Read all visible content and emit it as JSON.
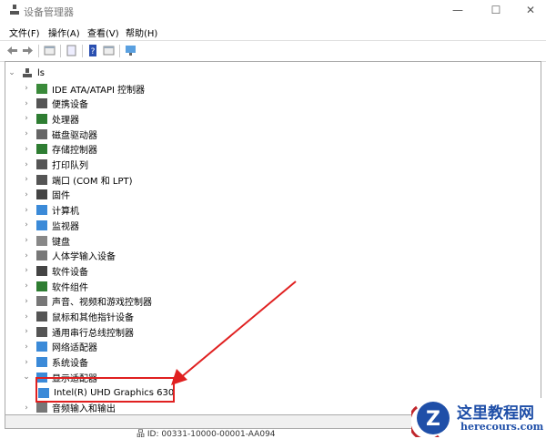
{
  "window": {
    "title": "设备管理器",
    "controls": [
      "—",
      "☐",
      "✕"
    ]
  },
  "menu": [
    "文件(F)",
    "操作(A)",
    "查看(V)",
    "帮助(H)"
  ],
  "toolbar": [
    "back-icon",
    "forward-icon",
    "show-hide-tree-icon",
    "properties-icon",
    "help-icon",
    "action-pane-icon",
    "monitor-icon"
  ],
  "tree": {
    "root": "ls",
    "items": [
      {
        "label": "IDE ATA/ATAPI 控制器",
        "icon": "#3a8a3a"
      },
      {
        "label": "便携设备",
        "icon": "#555"
      },
      {
        "label": "处理器",
        "icon": "#2e7d32"
      },
      {
        "label": "磁盘驱动器",
        "icon": "#666"
      },
      {
        "label": "存储控制器",
        "icon": "#2e7d32"
      },
      {
        "label": "打印队列",
        "icon": "#555"
      },
      {
        "label": "端口 (COM 和 LPT)",
        "icon": "#555"
      },
      {
        "label": "固件",
        "icon": "#444"
      },
      {
        "label": "计算机",
        "icon": "#3b8ad8"
      },
      {
        "label": "监视器",
        "icon": "#3b8ad8"
      },
      {
        "label": "键盘",
        "icon": "#888"
      },
      {
        "label": "人体学输入设备",
        "icon": "#777"
      },
      {
        "label": "软件设备",
        "icon": "#444"
      },
      {
        "label": "软件组件",
        "icon": "#2e7d32"
      },
      {
        "label": "声音、视频和游戏控制器",
        "icon": "#777"
      },
      {
        "label": "鼠标和其他指针设备",
        "icon": "#555"
      },
      {
        "label": "通用串行总线控制器",
        "icon": "#555"
      },
      {
        "label": "网络适配器",
        "icon": "#3b8ad8"
      },
      {
        "label": "系统设备",
        "icon": "#3b8ad8"
      },
      {
        "label": "显示适配器",
        "icon": "#3b8ad8",
        "expanded": true
      },
      {
        "label": "Intel(R) UHD Graphics 630",
        "icon": "#3b8ad8",
        "child": true
      },
      {
        "label": "音频输入和输出",
        "icon": "#777"
      }
    ]
  },
  "bottom_text": "品 ID: 00331-10000-00001-AA094",
  "watermark": {
    "name": "这里教程网",
    "url": "herecours.com"
  },
  "colors": {
    "highlight": "#e02020"
  }
}
